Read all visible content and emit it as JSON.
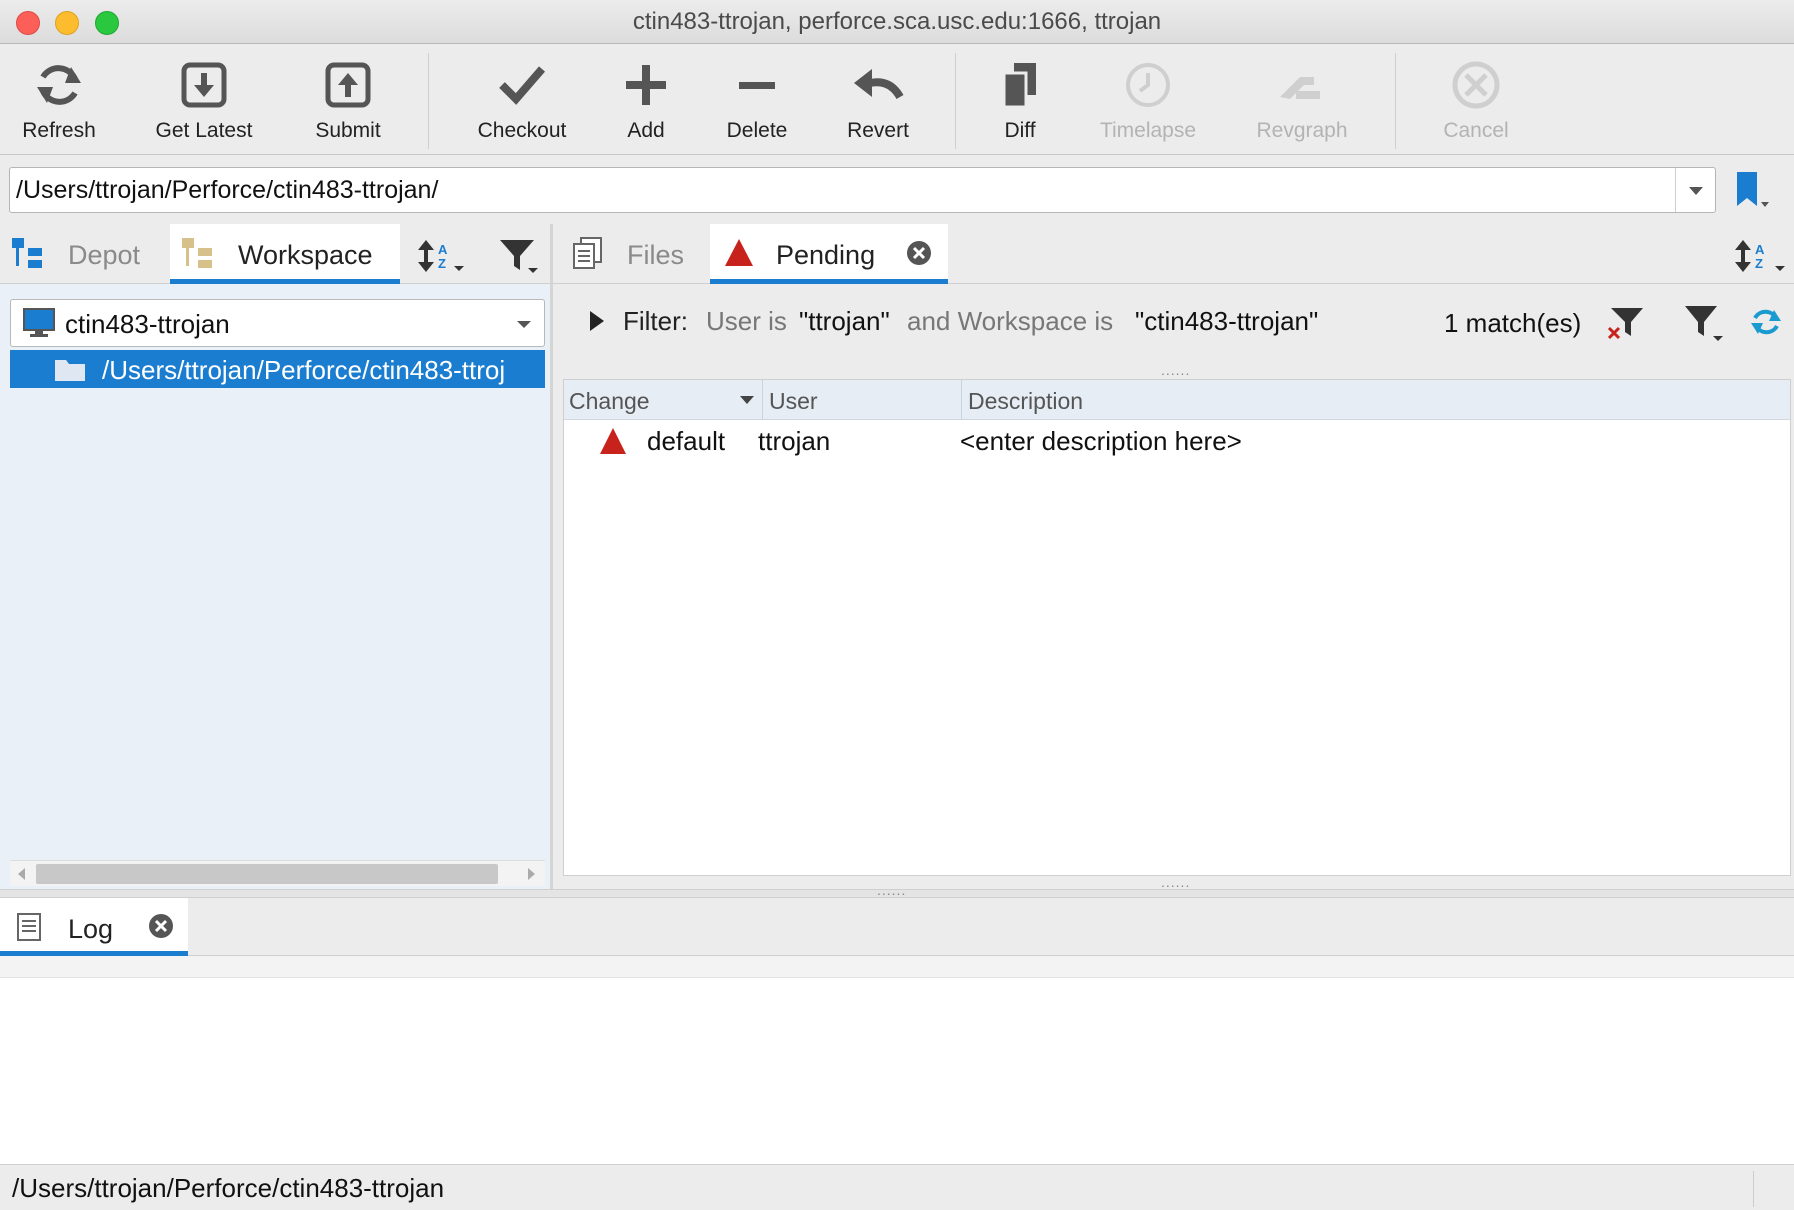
{
  "window": {
    "title": "ctin483-ttrojan,  perforce.sca.usc.edu:1666,  ttrojan"
  },
  "toolbar": {
    "buttons": [
      {
        "label": "Refresh",
        "icon": "refresh-icon",
        "enabled": true
      },
      {
        "label": "Get Latest",
        "icon": "get-latest-icon",
        "enabled": true
      },
      {
        "label": "Submit",
        "icon": "submit-icon",
        "enabled": true
      },
      {
        "label": "Checkout",
        "icon": "checkmark-icon",
        "enabled": true
      },
      {
        "label": "Add",
        "icon": "plus-icon",
        "enabled": true
      },
      {
        "label": "Delete",
        "icon": "minus-icon",
        "enabled": true
      },
      {
        "label": "Revert",
        "icon": "revert-arrow-icon",
        "enabled": true
      },
      {
        "label": "Diff",
        "icon": "diff-pages-icon",
        "enabled": true
      },
      {
        "label": "Timelapse",
        "icon": "clock-icon",
        "enabled": false
      },
      {
        "label": "Revgraph",
        "icon": "revgraph-icon",
        "enabled": false
      },
      {
        "label": "Cancel",
        "icon": "cancel-icon",
        "enabled": false
      }
    ]
  },
  "pathbar": {
    "value": "/Users/ttrojan/Perforce/ctin483-ttrojan/"
  },
  "left_panel": {
    "tabs": [
      {
        "label": "Depot",
        "active": false
      },
      {
        "label": "Workspace",
        "active": true
      }
    ],
    "workspace_select": "ctin483-ttrojan",
    "tree_row": "/Users/ttrojan/Perforce/ctin483-ttroj"
  },
  "right_panel": {
    "tabs": [
      {
        "label": "Files",
        "active": false
      },
      {
        "label": "Pending",
        "active": true
      }
    ],
    "filter": {
      "label": "Filter:",
      "text_a": "User is",
      "user": "\"ttrojan\"",
      "text_b": "and Workspace is",
      "workspace": "\"ctin483-ttrojan\"",
      "match_count": "1 match(es)"
    },
    "grid": {
      "columns": [
        "Change",
        "User",
        "Description"
      ],
      "rows": [
        {
          "change": "default",
          "user": "ttrojan",
          "description": "<enter description here>"
        }
      ]
    }
  },
  "log_panel": {
    "tab_label": "Log"
  },
  "statusbar": {
    "text": "/Users/ttrojan/Perforce/ctin483-ttrojan"
  },
  "colors": {
    "accent": "#1a7dd0",
    "pending_red": "#c8221c",
    "disabled_gray": "#b3b3b3",
    "refresh_teal": "#1a9bd0"
  }
}
